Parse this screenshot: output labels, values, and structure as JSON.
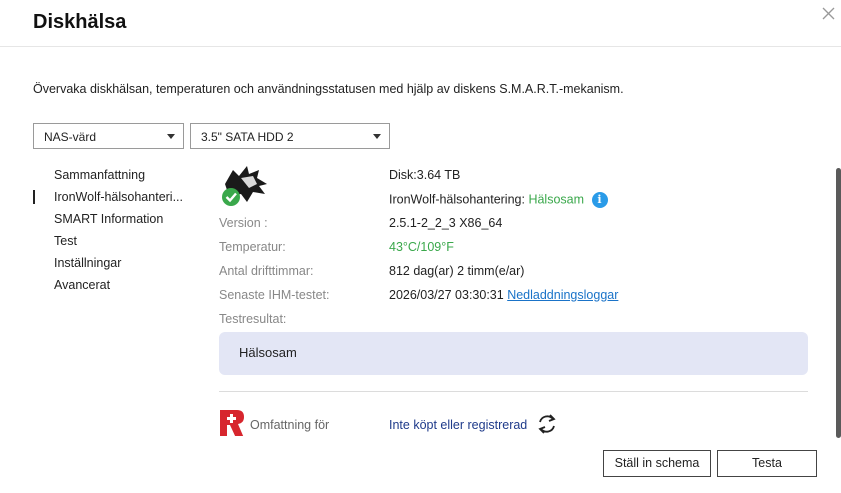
{
  "window": {
    "title": "Diskhälsa"
  },
  "description": "Övervaka diskhälsan, temperaturen och användningsstatusen med hjälp av diskens S.M.A.R.T.-mekanism.",
  "selectors": {
    "nas": {
      "value": "NAS-värd"
    },
    "disk": {
      "value": "3.5\" SATA HDD 2"
    }
  },
  "nav": {
    "items": [
      {
        "label": "Sammanfattning"
      },
      {
        "label": "IronWolf-hälsohanteri..."
      },
      {
        "label": "SMART Information"
      },
      {
        "label": "Test"
      },
      {
        "label": "Inställningar"
      },
      {
        "label": "Avancerat"
      }
    ],
    "active_index": 1
  },
  "details": {
    "disk": "Disk:3.64 TB",
    "ihm_label": "IronWolf-hälsohantering:",
    "ihm_status": "Hälsosam",
    "version_label": "Version :",
    "version_value": "2.5.1-2_2_3 X86_64",
    "temp_label": "Temperatur:",
    "temp_value": "43°C/109°F",
    "hours_label": "Antal drifttimmar:",
    "hours_value": "812 dag(ar) 2 timm(e/ar)",
    "last_test_label": "Senaste IHM-testet:",
    "last_test_value": "2026/03/27 03:30:31",
    "download_logs": "Nedladdningsloggar",
    "result_label": "Testresultat:",
    "result_value": "Hälsosam"
  },
  "coverage": {
    "label": "Omfattning för",
    "value": "Inte köpt eller registrerad"
  },
  "buttons": {
    "schedule": "Ställ in schema",
    "test": "Testa"
  },
  "colors": {
    "healthy_green": "#3aa84b",
    "link_blue": "#1a73c8",
    "info_blue": "#2a9be8",
    "result_bg": "#e3e6f5",
    "rescue_red": "#d7262e"
  },
  "icons": [
    "close-icon",
    "chevron-down-icon",
    "ironwolf-disk-icon",
    "check-icon",
    "info-icon",
    "rescue-icon",
    "refresh-icon"
  ]
}
